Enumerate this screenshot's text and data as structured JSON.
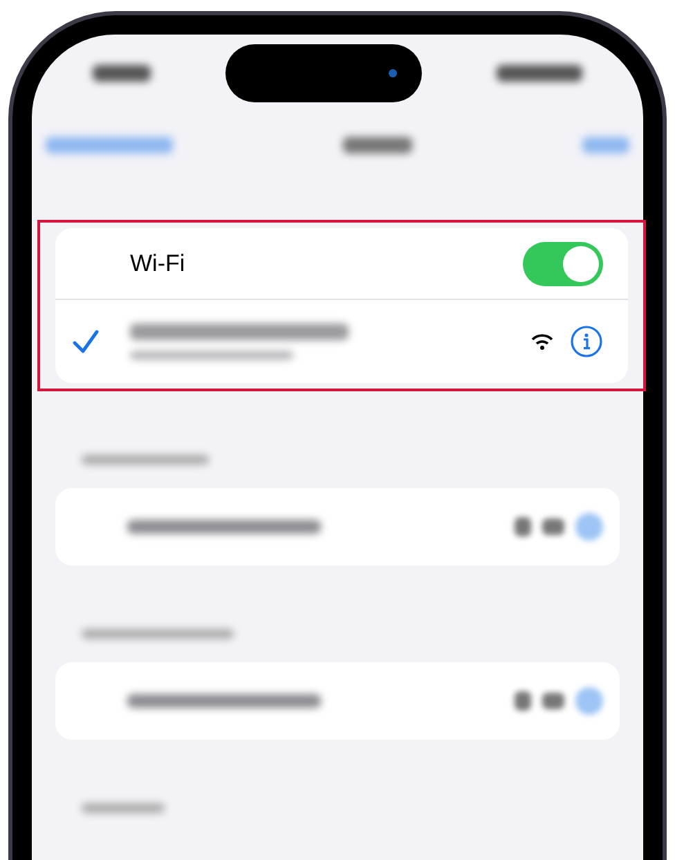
{
  "wifi": {
    "label": "Wi-Fi",
    "on": true
  },
  "network": {
    "selected": true
  }
}
